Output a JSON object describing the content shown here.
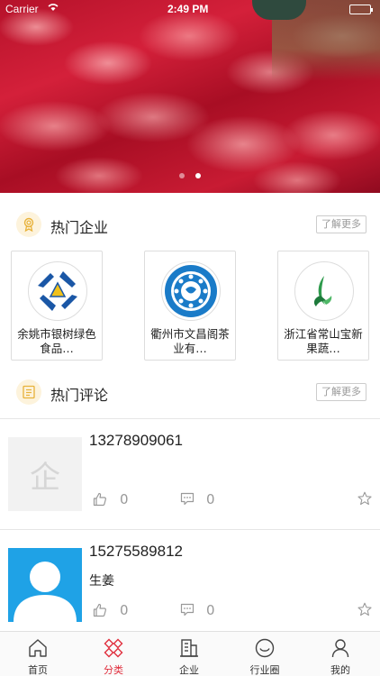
{
  "status_bar": {
    "carrier": "Carrier",
    "time": "2:49 PM"
  },
  "hero": {
    "slides": 2,
    "active_slide": 2
  },
  "hot_companies": {
    "title": "热门企业",
    "more_label": "了解更多",
    "items": [
      {
        "name": "余姚市银树绿色食品…"
      },
      {
        "name": "衢州市文昌阁茶业有…"
      },
      {
        "name": "浙江省常山宝新果蔬…"
      }
    ]
  },
  "hot_comments": {
    "title": "热门评论",
    "more_label": "了解更多",
    "items": [
      {
        "phone": "13278909061",
        "body": "",
        "likes": "0",
        "replies": "0",
        "avatar_placeholder": "企"
      },
      {
        "phone": "15275589812",
        "body": "生姜",
        "likes": "0",
        "replies": "0"
      }
    ]
  },
  "tabbar": {
    "items": [
      {
        "label": "首页",
        "icon": "home-icon"
      },
      {
        "label": "分类",
        "icon": "category-icon"
      },
      {
        "label": "企业",
        "icon": "company-icon"
      },
      {
        "label": "行业圈",
        "icon": "industry-circle-icon"
      },
      {
        "label": "我的",
        "icon": "profile-icon"
      }
    ],
    "active_index": 1,
    "active_color": "#e02e3d"
  }
}
